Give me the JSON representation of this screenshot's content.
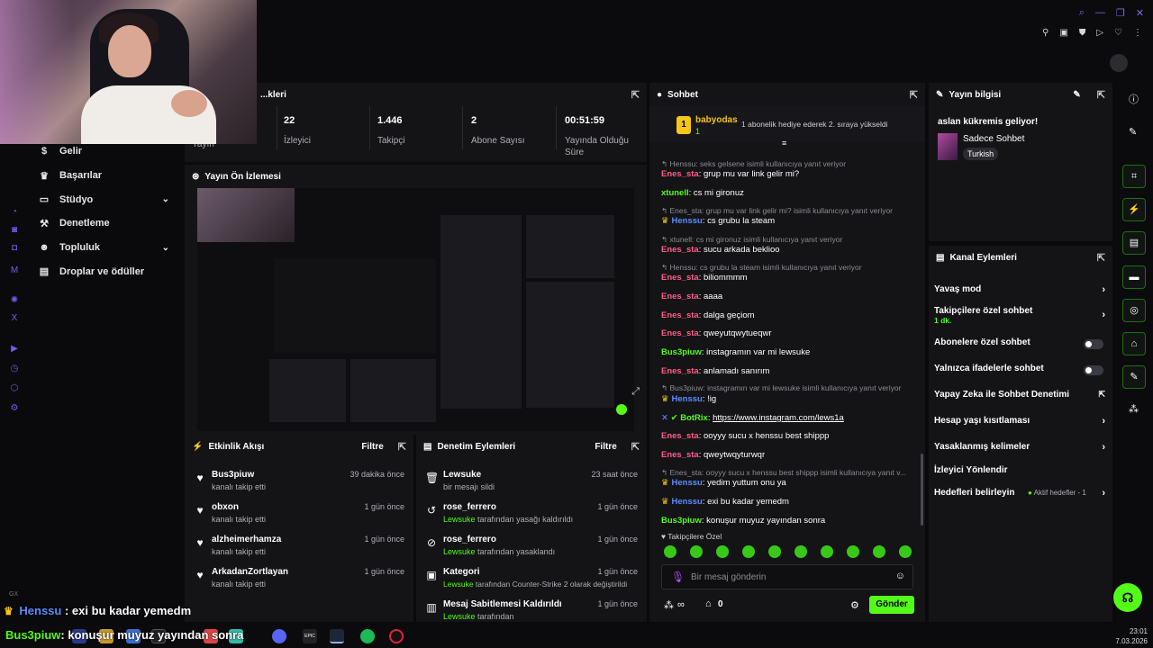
{
  "nav": {
    "items": [
      {
        "label": "Gelir",
        "icon": "income-icon"
      },
      {
        "label": "Başarılar",
        "icon": "trophy-icon"
      },
      {
        "label": "Stüdyo",
        "icon": "studio-icon"
      },
      {
        "label": "Denetleme",
        "icon": "gavel-icon"
      },
      {
        "label": "Topluluk",
        "icon": "community-icon"
      },
      {
        "label": "Droplar ve ödüller",
        "icon": "gift-icon"
      }
    ]
  },
  "stats": {
    "title": "...kleri",
    "first_label": "Yayın",
    "items": [
      {
        "value": "22",
        "label": "İzleyici"
      },
      {
        "value": "1.446",
        "label": "Takipçi"
      },
      {
        "value": "2",
        "label": "Abone Sayısı"
      },
      {
        "value": "00:51:59",
        "label": "Yayında Olduğu Süre"
      }
    ]
  },
  "preview": {
    "title": "Yayın Ön İzlemesi"
  },
  "activity": {
    "title": "Etkinlik Akışı",
    "filter": "Filtre",
    "rows": [
      {
        "name": "Bus3piuw",
        "sub": "kanalı takip etti",
        "time": "39 dakika önce"
      },
      {
        "name": "obxon",
        "sub": "kanalı takip etti",
        "time": "1 gün önce"
      },
      {
        "name": "alzheimerhamza",
        "sub": "kanalı takip etti",
        "time": "1 gün önce"
      },
      {
        "name": "ArkadanZortlayan",
        "sub": "kanalı takip etti",
        "time": "1 gün önce"
      }
    ]
  },
  "modlog": {
    "title": "Denetim Eylemleri",
    "filter": "Filtre",
    "rows": [
      {
        "name": "Lewsuke",
        "sub_green": "",
        "sub": "bir mesajı sildi",
        "time": "23 saat önce",
        "icon": "trash-icon"
      },
      {
        "name": "rose_ferrero",
        "sub_green": "Lewsuke",
        "sub": " tarafından yasağı kaldırıldı",
        "time": "1 gün önce",
        "icon": "undo-icon"
      },
      {
        "name": "rose_ferrero",
        "sub_green": "Lewsuke",
        "sub": " tarafından yasaklandı",
        "time": "1 gün önce",
        "icon": "ban-icon"
      },
      {
        "name": "Kategori",
        "sub_green": "Lewsuke",
        "sub": " tarafından Counter-Strike 2 olarak değiştirildi",
        "time": "1 gün önce",
        "icon": "category-icon"
      },
      {
        "name": "Mesaj Sabitlemesi Kaldırıldı",
        "sub_green": "Lewsuke",
        "sub": " tarafından",
        "time": "1 gün önce",
        "icon": "unpin-icon"
      }
    ]
  },
  "chat": {
    "title": "Sohbet",
    "pinned": {
      "user": "babyodas",
      "count": "1",
      "text": "1 abonelik hediye ederek 2. sıraya yükseldi",
      "rank": "1"
    },
    "lines": [
      {
        "type": "reply",
        "text": "Henssu: seks gelsene isimli kullanıcıya yanıt veriyor"
      },
      {
        "type": "msg",
        "user": "Enes_sta",
        "color": "pink",
        "text": "grup mu var link gelir mi?"
      },
      {
        "type": "msg",
        "user": "xtunell",
        "color": "green",
        "text": "cs mi gironuz"
      },
      {
        "type": "reply",
        "text": "Enes_sta: grup mu var link gelir mi? isimli kullanıcıya yanıt veriyor"
      },
      {
        "type": "msg",
        "user": "Henssu",
        "color": "blue",
        "crown": true,
        "text": "cs grubu la steam"
      },
      {
        "type": "reply",
        "text": "xtunell: cs mi gironuz isimli kullanıcıya yanıt veriyor"
      },
      {
        "type": "msg",
        "user": "Enes_sta",
        "color": "pink",
        "text": "sucu arkada beklioo"
      },
      {
        "type": "reply",
        "text": "Henssu: cs grubu la steam isimli kullanıcıya yanıt veriyor"
      },
      {
        "type": "msg",
        "user": "Enes_sta",
        "color": "pink",
        "text": "biliommmm"
      },
      {
        "type": "msg",
        "user": "Enes_sta",
        "color": "pink",
        "text": "aaaa"
      },
      {
        "type": "msg",
        "user": "Enes_sta",
        "color": "pink",
        "text": "dalga geçiom"
      },
      {
        "type": "msg",
        "user": "Enes_sta",
        "color": "pink",
        "text": "qweyutqwytueqwr"
      },
      {
        "type": "msg",
        "user": "Bus3piuw",
        "color": "green",
        "text": "instagramın var mi lewsuke"
      },
      {
        "type": "msg",
        "user": "Enes_sta",
        "color": "pink",
        "text": "anlamadı sanırım"
      },
      {
        "type": "reply",
        "text": "Bus3piuw: instagramın var mi lewsuke isimli kullanıcıya yanıt veriyor"
      },
      {
        "type": "msg",
        "user": "Henssu",
        "color": "blue",
        "crown": true,
        "text": "!ig"
      },
      {
        "type": "msg",
        "user": "BotRix",
        "color": "green",
        "bot": true,
        "text": "https://www.instagram.com/lews1a",
        "link": true
      },
      {
        "type": "msg",
        "user": "Enes_sta",
        "color": "pink",
        "text": "ooyyy sucu x henssu best shippp"
      },
      {
        "type": "msg",
        "user": "Enes_sta",
        "color": "pink",
        "text": "qweytwqyturwqr"
      },
      {
        "type": "reply",
        "text": "Enes_sta: ooyyy sucu x henssu best shippp isimli kullanıcıya yanıt v..."
      },
      {
        "type": "msg",
        "user": "Henssu",
        "color": "blue",
        "crown": true,
        "text": "yedim yuttum onu ya"
      },
      {
        "type": "msg",
        "user": "Henssu",
        "color": "blue",
        "crown": true,
        "text": "exi bu kadar yemedm"
      },
      {
        "type": "msg",
        "user": "Bus3piuw",
        "color": "green",
        "text": "konuşur muyuz yayından sonra"
      }
    ],
    "followers_only": "Takipçilere Özel",
    "placeholder": "Bir mesaj gönderin",
    "send": "Gönder",
    "points": "0",
    "infinity": "∞"
  },
  "info": {
    "title": "Yayın bilgisi",
    "stream_title": "aslan kükremis geliyor!",
    "category": "Sadece Sohbet",
    "tag": "Turkish"
  },
  "actions": {
    "title": "Kanal Eylemleri",
    "rows": [
      {
        "label": "Yavaş mod",
        "kind": "chevron"
      },
      {
        "label": "Takipçilere özel sohbet",
        "sub": "1 dk.",
        "kind": "chevron"
      },
      {
        "label": "Abonelere özel sohbet",
        "kind": "toggle"
      },
      {
        "label": "Yalnızca ifadelerle sohbet",
        "kind": "toggle"
      },
      {
        "label": "Yapay Zeka ile Sohbet Denetimi",
        "kind": "external"
      },
      {
        "label": "Hesap yaşı kısıtlaması",
        "kind": "chevron"
      },
      {
        "label": "Yasaklanmış kelimeler",
        "kind": "chevron"
      },
      {
        "label": "İzleyici Yönlendir",
        "kind": "none"
      },
      {
        "label": "Hedefleri belirleyin",
        "kind": "goals",
        "extra": "Aktif hedefler - 1"
      }
    ]
  },
  "overlay": {
    "line1_user": "Henssu",
    "line1_text": ": exi bu kadar yemedm",
    "line2_user": "Bus3piuw",
    "line2_text": ": konuşur muyuz yayından sonra",
    "tag": "GX"
  },
  "taskbar": {
    "time": "23:01",
    "date": "7.03.2026",
    "epic": "EPIC"
  },
  "colors": {
    "accent": "#53fc18",
    "panel": "#141417",
    "background": "#0a0a0c",
    "pink_user": "#ff5c8a",
    "blue_user": "#5b8cff",
    "gold": "#f5c518"
  }
}
